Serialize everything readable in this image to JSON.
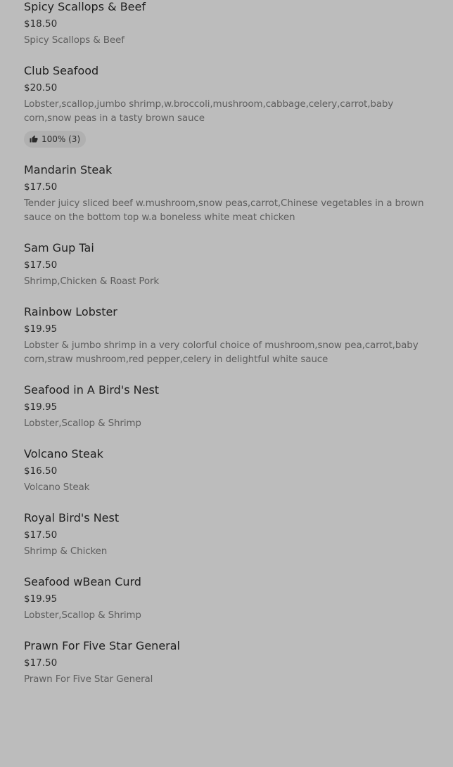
{
  "menu": {
    "items": [
      {
        "name": "Spicy Scallops & Beef",
        "price": "$18.50",
        "description": "Spicy Scallops & Beef"
      },
      {
        "name": "Club Seafood",
        "price": "$20.50",
        "description": "Lobster,scallop,jumbo shrimp,w.broccoli,mushroom,cabbage,celery,carrot,baby corn,snow peas in a tasty brown sauce",
        "rating": "100% (3)"
      },
      {
        "name": "Mandarin Steak",
        "price": "$17.50",
        "description": "Tender juicy sliced beef w.mushroom,snow peas,carrot,Chinese vegetables in a brown sauce on the bottom top w.a boneless white meat chicken"
      },
      {
        "name": "Sam Gup Tai",
        "price": "$17.50",
        "description": "Shrimp,Chicken & Roast Pork"
      },
      {
        "name": "Rainbow Lobster",
        "price": "$19.95",
        "description": "Lobster & jumbo shrimp in a very colorful choice of mushroom,snow pea,carrot,baby corn,straw mushroom,red pepper,celery in delightful white sauce"
      },
      {
        "name": "Seafood in A Bird's Nest",
        "price": "$19.95",
        "description": "Lobster,Scallop & Shrimp"
      },
      {
        "name": "Volcano Steak",
        "price": "$16.50",
        "description": "Volcano Steak"
      },
      {
        "name": "Royal Bird's Nest",
        "price": "$17.50",
        "description": "Shrimp & Chicken"
      },
      {
        "name": "Seafood wBean Curd",
        "price": "$19.95",
        "description": "Lobster,Scallop & Shrimp"
      },
      {
        "name": "Prawn For Five Star General",
        "price": "$17.50",
        "description": "Prawn For Five Star General"
      }
    ]
  },
  "icons": {
    "rating": "thumbs-up-icon"
  },
  "colors": {
    "background": "#bcbcbc",
    "name": "#1f1f1f",
    "description": "#5e5e5e",
    "badge": "#b0b0b0"
  }
}
